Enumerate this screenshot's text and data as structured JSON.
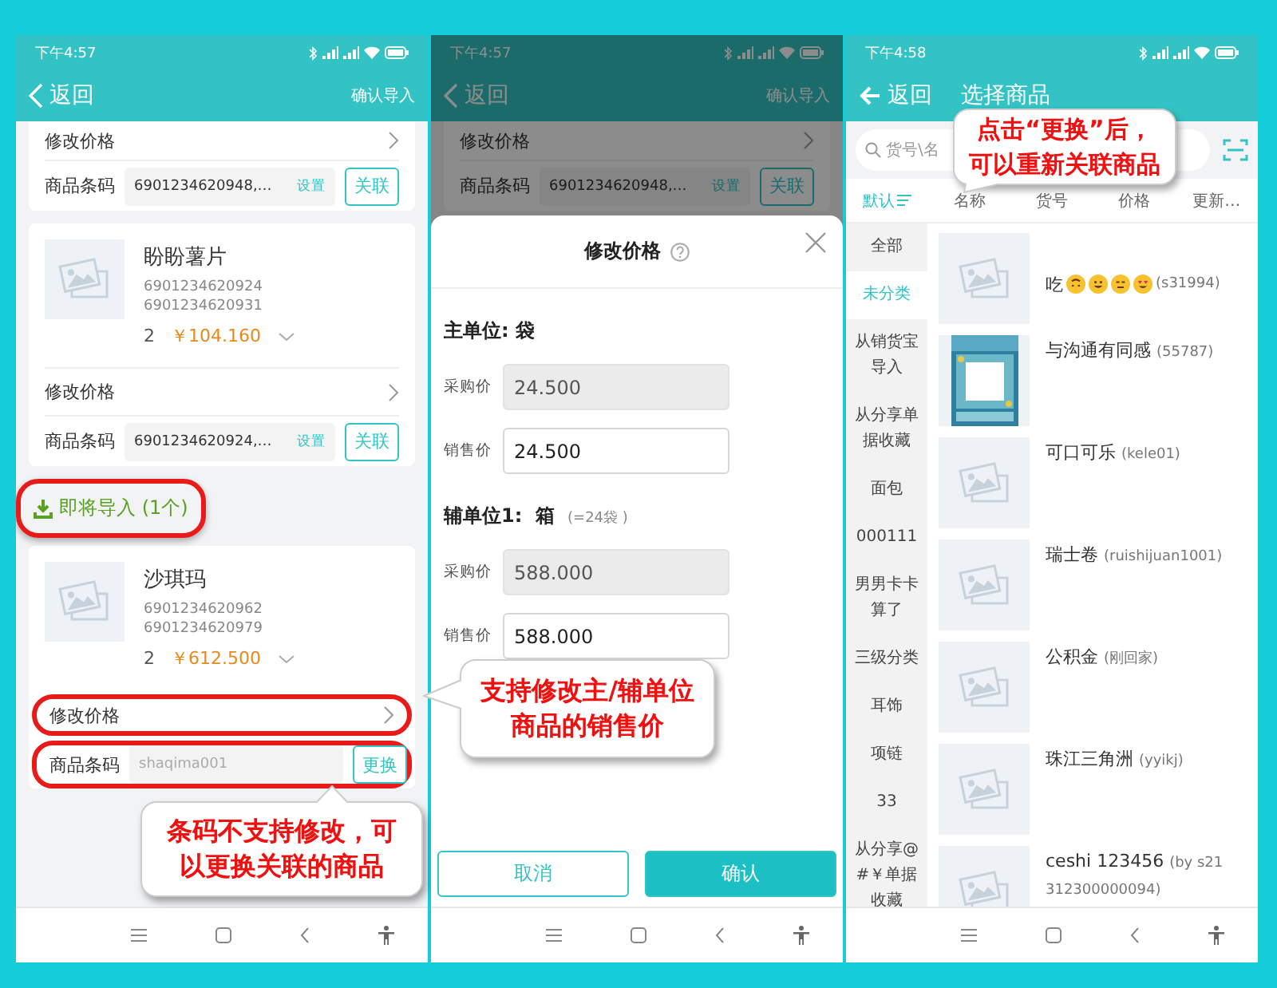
{
  "import_screen": {
    "status": {
      "time": "下午4:57"
    },
    "header": {
      "back": "返回",
      "action": "确认导入"
    },
    "items": [
      {
        "kind": "card",
        "price_row": {
          "label": "修改价格",
          "highlighted": false
        },
        "barcode": {
          "label": "商品条码",
          "value": "6901234620948,…",
          "link": "设置",
          "button": "关联",
          "highlighted": false
        }
      },
      {
        "kind": "card",
        "name": "盼盼薯片",
        "codes": [
          "6901234620924",
          "6901234620931"
        ],
        "quantity": "2",
        "price": "￥104.160",
        "price_row": {
          "label": "修改价格",
          "highlighted": false
        },
        "barcode": {
          "label": "商品条码",
          "value": "6901234620924,…",
          "link": "设置",
          "button": "关联",
          "highlighted": false
        }
      },
      {
        "kind": "section",
        "title": "即将导入 (1个)",
        "highlighted": true
      },
      {
        "kind": "card",
        "name": "沙琪玛",
        "codes": [
          "6901234620962",
          "6901234620979"
        ],
        "quantity": "2",
        "price": "￥612.500",
        "price_row": {
          "label": "修改价格",
          "highlighted": true
        },
        "barcode": {
          "label": "商品条码",
          "placeholder": "shaqima001",
          "button": "更换",
          "highlighted": true
        }
      }
    ]
  },
  "price_dialog_screen": {
    "status": {
      "time": "下午4:57"
    },
    "header": {
      "back": "返回",
      "action": "确认导入"
    },
    "background": {
      "price_row": {
        "label": "修改价格"
      },
      "barcode": {
        "label": "商品条码",
        "value": "6901234620948,…",
        "link": "设置",
        "button": "关联"
      }
    },
    "sheet": {
      "title": "修改价格",
      "units": [
        {
          "title": "主单位: 袋",
          "fields": [
            {
              "label": "采购价",
              "value": "24.500",
              "disabled": true
            },
            {
              "label": "销售价",
              "value": "24.500",
              "disabled": false
            }
          ]
        },
        {
          "title": "辅单位1:  箱",
          "note": "(=24袋 )",
          "fields": [
            {
              "label": "采购价",
              "value": "588.000",
              "disabled": true
            },
            {
              "label": "销售价",
              "value": "588.000",
              "disabled": false
            }
          ]
        }
      ],
      "buttons": [
        {
          "label": "取消",
          "kind": "secondary"
        },
        {
          "label": "确认",
          "kind": "primary"
        }
      ]
    }
  },
  "select_product_screen": {
    "status": {
      "time": "下午4:58"
    },
    "header": {
      "back": "返回",
      "title": "选择商品"
    },
    "search": {
      "placeholder": "货号\\名"
    },
    "sort": [
      {
        "label": "默认",
        "selected": true
      },
      {
        "label": "名称",
        "selected": false
      },
      {
        "label": "货号",
        "selected": false
      },
      {
        "label": "价格",
        "selected": false
      },
      {
        "label": "更新…",
        "selected": false
      }
    ],
    "categories": [
      {
        "label": "全部",
        "selected": false
      },
      {
        "label": "未分类",
        "selected": true
      },
      {
        "label": "从销货宝导入",
        "selected": false
      },
      {
        "label": "从分享单据收藏",
        "selected": false
      },
      {
        "label": "面包",
        "selected": false
      },
      {
        "label": "000111",
        "selected": false
      },
      {
        "label": "男男卡卡算了",
        "selected": false
      },
      {
        "label": "三级分类",
        "selected": false
      },
      {
        "label": "耳饰",
        "selected": false
      },
      {
        "label": "项链",
        "selected": false
      },
      {
        "label": "33",
        "selected": false
      },
      {
        "label": "从分享@#￥单据收藏",
        "selected": false
      }
    ],
    "products": [
      {
        "kind": "emoji_name",
        "name": "吃",
        "code": "(s31994)"
      },
      {
        "kind": "picture",
        "name": "与沟通有同感",
        "code": "(55787)"
      },
      {
        "kind": "plain",
        "name": "可口可乐",
        "code": "(kele01)"
      },
      {
        "kind": "plain",
        "name": "瑞士卷",
        "code": "(ruishijuan1001)"
      },
      {
        "kind": "plain",
        "name": "公积金",
        "code": "(刚回家)"
      },
      {
        "kind": "plain",
        "name": "珠江三角洲",
        "code": "(yyikj)"
      },
      {
        "kind": "plain",
        "name": "ceshi 123456",
        "code": "(by s21312300000094)"
      }
    ]
  },
  "callouts": [
    {
      "text": "条码不支持修改，可以更换关联的商品"
    },
    {
      "text": "支持修改主/辅单位商品的销售价"
    },
    {
      "text": "点击“更换”后，可以重新关联商品"
    }
  ]
}
